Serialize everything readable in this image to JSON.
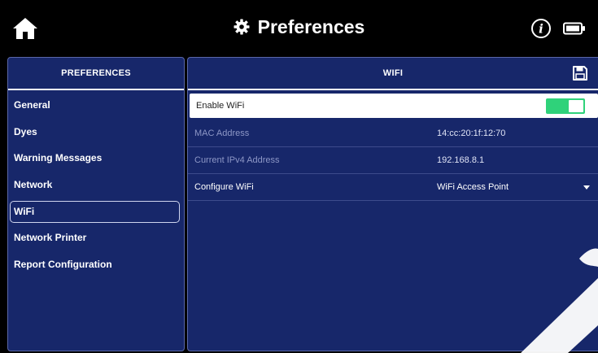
{
  "header": {
    "title": "Preferences",
    "icons": [
      "home-icon",
      "gear-icon",
      "info-icon",
      "battery-icon"
    ]
  },
  "sidebar": {
    "title": "PREFERENCES",
    "selected_index": 4,
    "items": [
      {
        "label": "General"
      },
      {
        "label": "Dyes"
      },
      {
        "label": "Warning Messages"
      },
      {
        "label": "Network"
      },
      {
        "label": "WiFi"
      },
      {
        "label": "Network Printer"
      },
      {
        "label": "Report Configuration"
      }
    ]
  },
  "main": {
    "title": "WIFI",
    "save_icon": "save-icon",
    "enable_wifi": {
      "label": "Enable WiFi",
      "on": true
    },
    "mac": {
      "label": "MAC Address",
      "value": "14:cc:20:1f:12:70"
    },
    "ipv4": {
      "label": "Current IPv4 Address",
      "value": "192.168.8.1"
    },
    "configure": {
      "label": "Configure WiFi",
      "value": "WiFi Access Point"
    }
  },
  "colors": {
    "panel": "#17276a",
    "toggle_on": "#2fd27a",
    "background": "#000000"
  }
}
